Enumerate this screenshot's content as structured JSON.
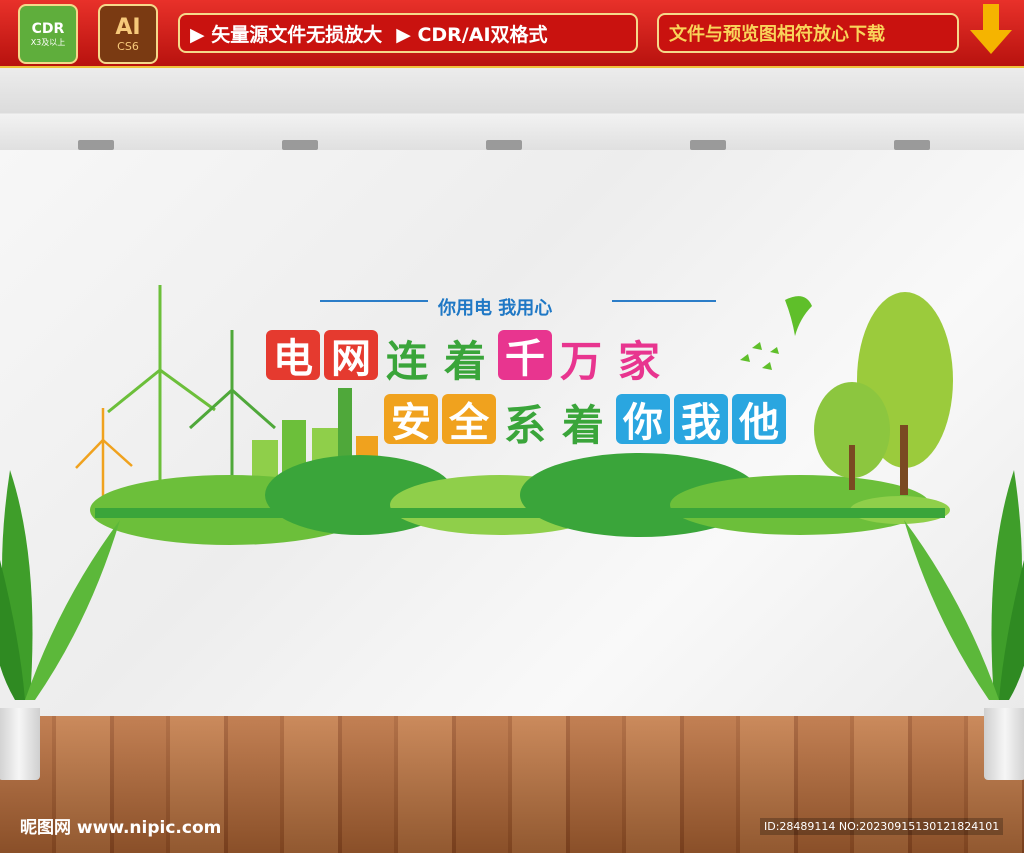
{
  "banner": {
    "cdr_label": "CDR",
    "cdr_sub": "X3及以上",
    "ai_label": "AI",
    "ai_sub": "CS6",
    "feature_1": "▶ 矢量源文件无损放大",
    "feature_2": "▶ CDR/AI双格式",
    "feature_3": "文件与预览图相符放心下载"
  },
  "board": {
    "subtitle": "你用电 我用心",
    "line1": [
      {
        "char": "电",
        "color": "#e53a2f",
        "tile": true
      },
      {
        "char": "网",
        "color": "#e53a2f",
        "tile": true
      },
      {
        "char": "连",
        "color": "#3aa53a",
        "tile": false
      },
      {
        "char": "着",
        "color": "#3aa53a",
        "tile": false
      },
      {
        "char": "千",
        "color": "#e8358f",
        "tile": true
      },
      {
        "char": "万",
        "color": "#e8358f",
        "tile": false
      },
      {
        "char": "家",
        "color": "#e8358f",
        "tile": false
      }
    ],
    "line2": [
      {
        "char": "安",
        "color": "#f0a21e",
        "tile": true
      },
      {
        "char": "全",
        "color": "#f0a21e",
        "tile": true
      },
      {
        "char": "系",
        "color": "#3aa53a",
        "tile": false
      },
      {
        "char": "着",
        "color": "#3aa53a",
        "tile": false
      },
      {
        "char": "你",
        "color": "#2aa6e0",
        "tile": true
      },
      {
        "char": "我",
        "color": "#2aa6e0",
        "tile": true
      },
      {
        "char": "他",
        "color": "#2aa6e0",
        "tile": true
      }
    ]
  },
  "footer": {
    "watermark": "昵图网 www.nipic.com",
    "id_text": "ID:28489114 NO:20230915130121824101"
  },
  "colors": {
    "banner_red": "#c9120f",
    "accent_gold": "#f5d98a",
    "green": "#3aa53a"
  }
}
